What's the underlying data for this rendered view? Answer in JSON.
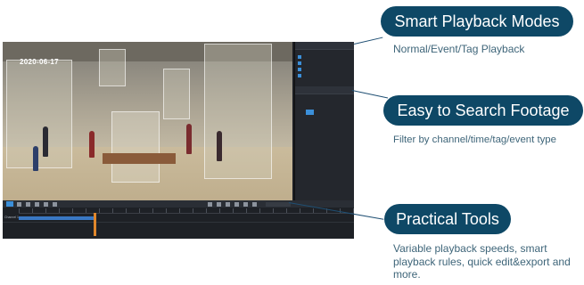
{
  "video": {
    "timestamp": "2020-06-17"
  },
  "sidebar": {
    "mode_label": "",
    "channels": [
      "",
      "",
      "",
      ""
    ],
    "calendar_label": "",
    "calendar_days": [
      "",
      "",
      "",
      "",
      "",
      "",
      "",
      "",
      "",
      "",
      "",
      "",
      "",
      "",
      "",
      "",
      "",
      "",
      "",
      "",
      "",
      "",
      "",
      "",
      "",
      "",
      "",
      "",
      "",
      "",
      "",
      "",
      "",
      "",
      ""
    ]
  },
  "timeline": {
    "channel_label": "Channel 1"
  },
  "features": [
    {
      "title": "Smart Playback Modes",
      "caption": "Normal/Event/Tag Playback"
    },
    {
      "title": "Easy to Search Footage",
      "caption": "Filter by channel/time/tag/event type"
    },
    {
      "title": "Practical Tools",
      "caption": "Variable playback speeds, smart playback rules, quick edit&export and more."
    }
  ],
  "colors": {
    "pill": "#0e4866",
    "caption": "#3e6579",
    "accent": "#3b8fd9",
    "cursor": "#e0872c"
  }
}
